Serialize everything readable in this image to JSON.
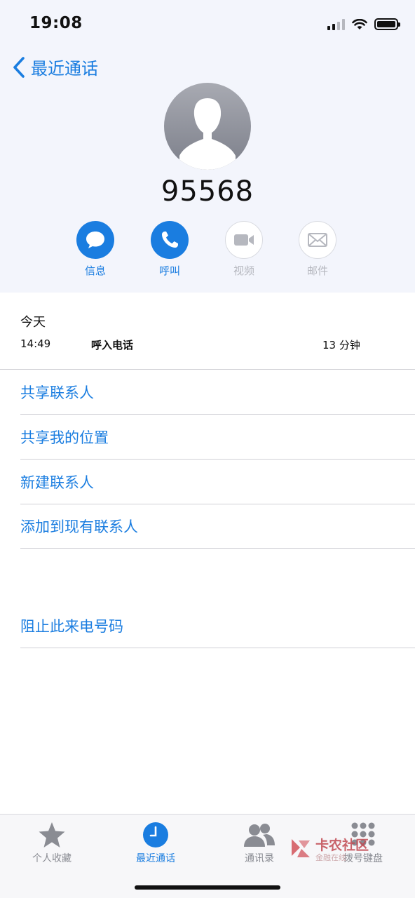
{
  "status_bar": {
    "time": "19:08"
  },
  "nav": {
    "back_label": "最近通话"
  },
  "contact": {
    "number": "95568"
  },
  "actions": [
    {
      "label": "信息",
      "icon": "message-icon",
      "enabled": true
    },
    {
      "label": "呼叫",
      "icon": "phone-icon",
      "enabled": true
    },
    {
      "label": "视频",
      "icon": "video-icon",
      "enabled": false
    },
    {
      "label": "邮件",
      "icon": "mail-icon",
      "enabled": false
    }
  ],
  "history": {
    "date": "今天",
    "time": "14:49",
    "type": "呼入电话",
    "duration": "13 分钟"
  },
  "options": [
    "共享联系人",
    "共享我的位置",
    "新建联系人",
    "添加到现有联系人"
  ],
  "block_option": "阻止此来电号码",
  "tabbar": [
    {
      "label": "个人收藏",
      "icon": "star-icon",
      "active": false
    },
    {
      "label": "最近通话",
      "icon": "clock-icon",
      "active": true
    },
    {
      "label": "通讯录",
      "icon": "contacts-icon",
      "active": false
    },
    {
      "label": "拨号键盘",
      "icon": "keypad-icon",
      "active": false
    }
  ],
  "watermark": {
    "title": "卡农社区",
    "subtitle": "金融在线"
  },
  "colors": {
    "accent": "#1a7de0",
    "disabled": "#b6b8bf",
    "header_bg": "#f3f5fc"
  }
}
